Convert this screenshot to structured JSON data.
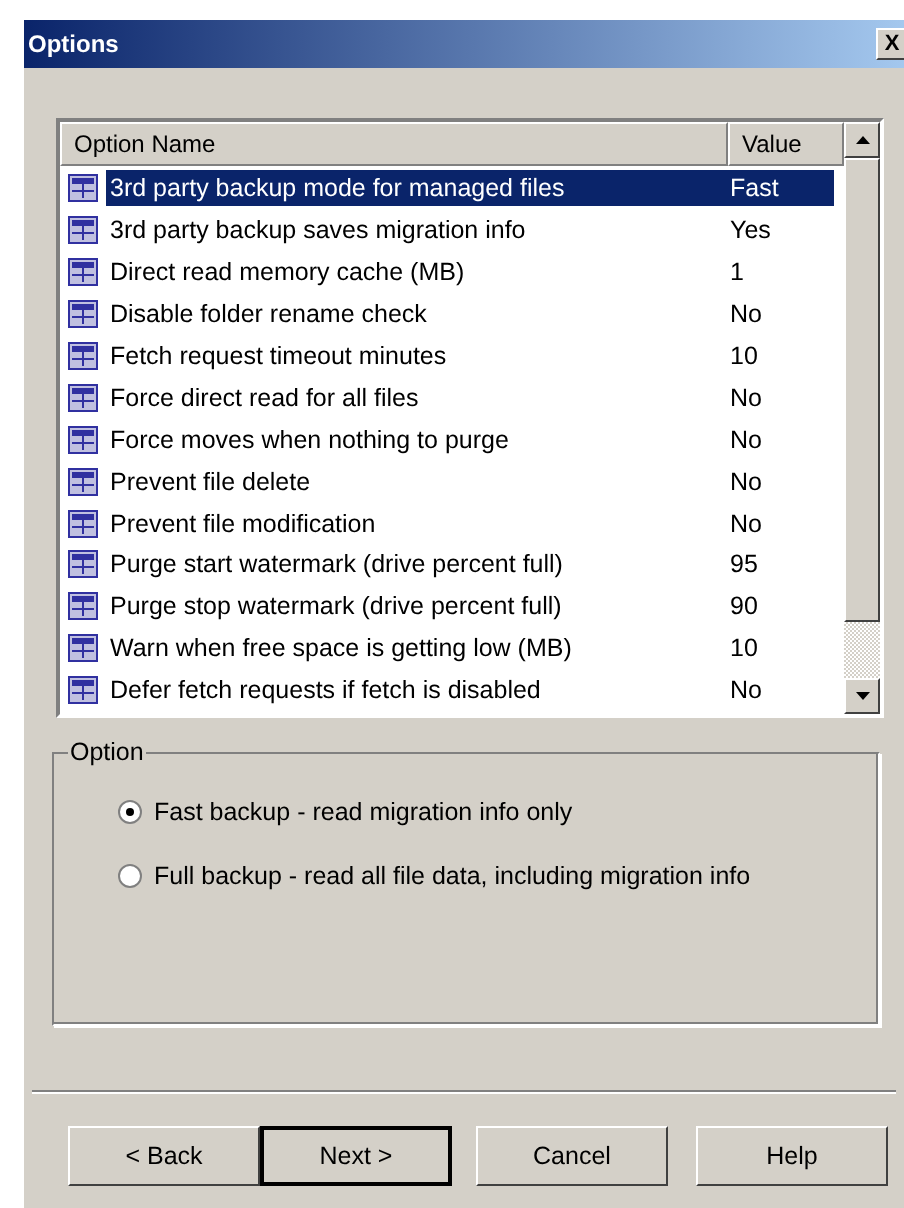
{
  "window": {
    "title": "Options",
    "close": "X"
  },
  "table": {
    "columns": [
      "Option Name",
      "Value"
    ],
    "rows": [
      {
        "name": "3rd party backup mode for managed files",
        "value": "Fast",
        "selected": true
      },
      {
        "name": "3rd party backup saves migration info",
        "value": "Yes",
        "selected": false
      },
      {
        "name": "Direct read memory cache (MB)",
        "value": "1",
        "selected": false
      },
      {
        "name": "Disable folder rename check",
        "value": "No",
        "selected": false
      },
      {
        "name": "Fetch request timeout minutes",
        "value": "10",
        "selected": false
      },
      {
        "name": "Force direct read for all files",
        "value": "No",
        "selected": false
      },
      {
        "name": "Force moves when nothing to purge",
        "value": "No",
        "selected": false
      },
      {
        "name": "Prevent file delete",
        "value": "No",
        "selected": false
      },
      {
        "name": "Prevent file modification",
        "value": "No",
        "selected": false
      },
      {
        "name": "Purge start watermark (drive percent full)",
        "value": "95",
        "selected": false
      },
      {
        "name": "Purge stop watermark (drive percent full)",
        "value": "90",
        "selected": false
      },
      {
        "name": "Warn when free space is getting low (MB)",
        "value": "10",
        "selected": false
      },
      {
        "name": "Defer fetch requests if fetch is disabled",
        "value": "No",
        "selected": false
      }
    ]
  },
  "option_group": {
    "title": "Option",
    "options": [
      {
        "label": "Fast backup - read migration info only",
        "selected": true
      },
      {
        "label": "Full backup - read all file data, including migration info",
        "selected": false
      }
    ]
  },
  "buttons": [
    {
      "label": "< Back",
      "default": false
    },
    {
      "label": "Next >",
      "default": true
    },
    {
      "label": "Cancel",
      "default": false
    },
    {
      "label": "Help",
      "default": false
    }
  ]
}
